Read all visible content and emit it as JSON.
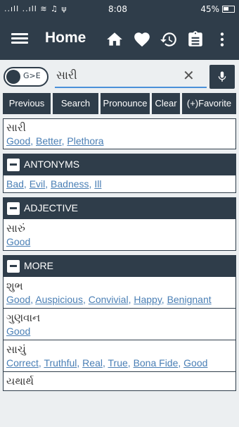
{
  "status": {
    "signal": "..ıll ..ıll ≋ ♫ ψ",
    "time": "8:08",
    "battery": "45%"
  },
  "appbar": {
    "title": "Home",
    "icons": [
      "home-icon",
      "heart-icon",
      "history-icon",
      "clipboard-icon",
      "more-vert-icon"
    ]
  },
  "search": {
    "toggle_label": "G>E",
    "query": "સારી"
  },
  "buttons": {
    "previous": "Previous",
    "search": "Search",
    "pronounce": "Pronounce",
    "clear": "Clear",
    "favorite": "(+)Favorite"
  },
  "main": {
    "word": "સારી",
    "meanings": [
      "Good",
      "Better",
      "Plethora"
    ]
  },
  "antonyms": {
    "title": "ANTONYMS",
    "items": [
      "Bad",
      "Evil",
      "Badness",
      "Ill"
    ]
  },
  "adjective": {
    "title": "ADJECTIVE",
    "word": "સારું",
    "meanings": [
      "Good"
    ]
  },
  "more": {
    "title": "MORE",
    "entries": [
      {
        "word": "શુભ",
        "meanings": [
          "Good",
          "Auspicious",
          "Convivial",
          "Happy",
          "Benignant"
        ]
      },
      {
        "word": "ગુણવાન",
        "meanings": [
          "Good"
        ]
      },
      {
        "word": "સાચું",
        "meanings": [
          "Correct",
          "Truthful",
          "Real",
          "True",
          "Bona Fide",
          "Good"
        ]
      },
      {
        "word": "યથાર્થ",
        "meanings": []
      }
    ]
  }
}
